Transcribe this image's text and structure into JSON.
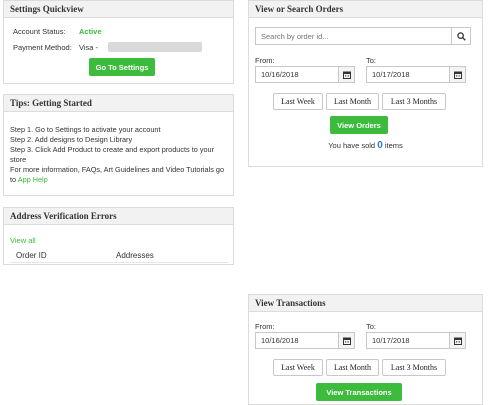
{
  "settings": {
    "title": "Settings Quickview",
    "account_status_label": "Account Status:",
    "account_status_value": "Active",
    "payment_method_label": "Payment Method:",
    "payment_method_value": "Visa -",
    "go_settings_label": "Go To Settings"
  },
  "tips": {
    "title": "Tips: Getting Started",
    "step1": "Step 1. Go to Settings to activate your account",
    "step2": "Step 2. Add designs to Design Library",
    "step3": "Step 3. Click Add Product to create and export products to your store",
    "more": "For more information, FAQs, Art Guidelines and Video Tutorials go to",
    "help_link": "App Help"
  },
  "address_errors": {
    "title": "Address Verification Errors",
    "view_all": "View all",
    "col_order_id": "Order ID",
    "col_addresses": "Addresses"
  },
  "orders": {
    "title": "View or Search Orders",
    "search_placeholder": "Search by order id...",
    "from_label": "From:",
    "to_label": "To:",
    "from_date": "10/16/2018",
    "to_date": "10/17/2018",
    "last_week": "Last Week",
    "last_month": "Last Month",
    "last_3_months": "Last 3 Months",
    "view_orders": "View Orders",
    "sold_prefix": "You have sold",
    "sold_count": "0",
    "sold_suffix": "items"
  },
  "transactions": {
    "title": "View Transactions",
    "from_label": "From:",
    "to_label": "To:",
    "from_date": "10/16/2018",
    "to_date": "10/17/2018",
    "last_week": "Last Week",
    "last_month": "Last Month",
    "last_3_months": "Last 3 Months",
    "view_transactions": "View Transactions"
  },
  "colors": {
    "accent_green": "#3cbb3c",
    "link_blue": "#2a7fd4"
  },
  "icons": {
    "search": "search-icon",
    "calendar": "calendar-icon"
  }
}
